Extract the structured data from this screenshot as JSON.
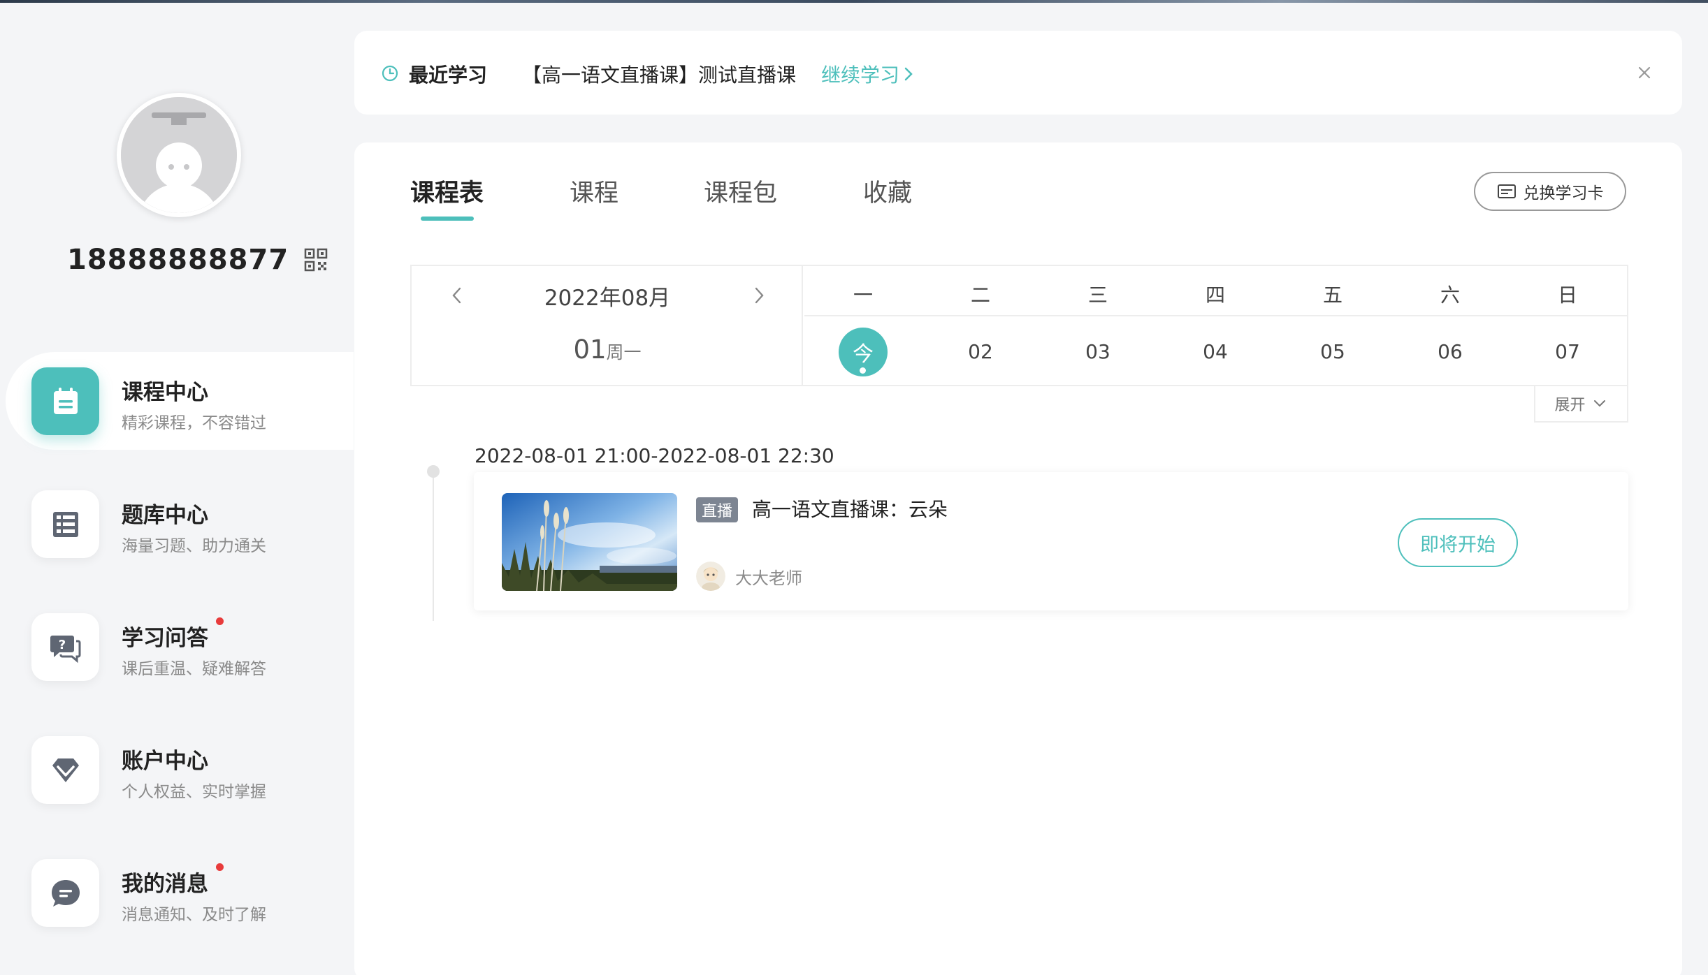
{
  "user": {
    "phone": "18888888877"
  },
  "nav": {
    "items": [
      {
        "title": "课程中心",
        "subtitle": "精彩课程，不容错过",
        "active": true,
        "icon": "calendar-icon"
      },
      {
        "title": "题库中心",
        "subtitle": "海量习题、助力通关",
        "active": false,
        "icon": "list-icon"
      },
      {
        "title": "学习问答",
        "subtitle": "课后重温、疑难解答",
        "active": false,
        "icon": "question-chat-icon",
        "badge": true
      },
      {
        "title": "账户中心",
        "subtitle": "个人权益、实时掌握",
        "active": false,
        "icon": "diamond-icon"
      },
      {
        "title": "我的消息",
        "subtitle": "消息通知、及时了解",
        "active": false,
        "icon": "message-icon",
        "badge": true
      }
    ]
  },
  "recent": {
    "label": "最近学习",
    "course": "【高一语文直播课】测试直播课",
    "continue_label": "继续学习"
  },
  "tabs": [
    {
      "label": "课程表",
      "active": true
    },
    {
      "label": "课程",
      "active": false
    },
    {
      "label": "课程包",
      "active": false
    },
    {
      "label": "收藏",
      "active": false
    }
  ],
  "redeem_label": "兑换学习卡",
  "calendar": {
    "month": "2022年08月",
    "selected_day": "01",
    "selected_weekday": "周一",
    "weekdays": [
      "一",
      "二",
      "三",
      "四",
      "五",
      "六",
      "日"
    ],
    "dates": [
      "今",
      "02",
      "03",
      "04",
      "05",
      "06",
      "07"
    ],
    "expand_label": "展开"
  },
  "schedule": {
    "time": "2022-08-01 21:00-2022-08-01 22:30",
    "badge": "直播",
    "title": "高一语文直播课：云朵",
    "teacher": "大大老师",
    "action_label": "即将开始"
  },
  "colors": {
    "accent": "#4dbfbb",
    "badge_red": "#e83b3b"
  }
}
